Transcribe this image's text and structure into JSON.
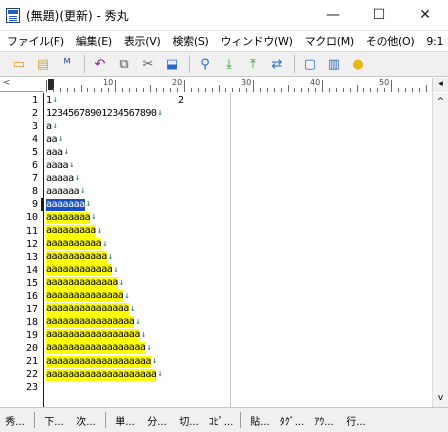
{
  "window": {
    "title": "(無題)(更新) - 秀丸",
    "minimize_glyph": "—",
    "maximize_glyph": "☐",
    "close_glyph": "✕"
  },
  "menu": [
    {
      "label": "ファイル(F)"
    },
    {
      "label": "編集(E)"
    },
    {
      "label": "表示(V)"
    },
    {
      "label": "検索(S)"
    },
    {
      "label": "ウィンドウ(W)"
    },
    {
      "label": "マクロ(M)"
    },
    {
      "label": "その他(O)"
    },
    {
      "label": "9:1"
    }
  ],
  "toolbar": [
    {
      "icon": "new-file-icon",
      "glyph": "▭",
      "color": "#d89a2b"
    },
    {
      "icon": "open-folder-icon",
      "glyph": "▤",
      "color": "#d8a83a"
    },
    {
      "icon": "save-icon",
      "glyph": "ᴹ",
      "color": "#1c3f8f"
    },
    {
      "icon": "undo-icon",
      "glyph": "↶",
      "color": "#8e1b80"
    },
    {
      "icon": "copy-icon",
      "glyph": "⧉",
      "color": "#5a5a5a"
    },
    {
      "icon": "cut-icon",
      "glyph": "✂",
      "color": "#5a5a5a"
    },
    {
      "icon": "paste-icon",
      "glyph": "⬓",
      "color": "#2b6bd0"
    },
    {
      "icon": "search-icon",
      "glyph": "⚲",
      "color": "#2b6bd0"
    },
    {
      "icon": "search-down-icon",
      "glyph": "⤓",
      "color": "#2a9c2a"
    },
    {
      "icon": "search-up-icon",
      "glyph": "⤒",
      "color": "#2a9c2a"
    },
    {
      "icon": "grep-icon",
      "glyph": "⇄",
      "color": "#2b6bd0"
    },
    {
      "icon": "window-split-icon",
      "glyph": "▢",
      "color": "#2b6bd0"
    },
    {
      "icon": "window-layout-icon",
      "glyph": "▥",
      "color": "#2b6bd0"
    },
    {
      "icon": "help-icon",
      "glyph": "●",
      "color": "#e8b51a"
    }
  ],
  "ruler": {
    "corner": "<",
    "scroll_glyph": "◂",
    "numbers": [
      "10",
      "20",
      "30",
      "40",
      "50"
    ]
  },
  "colors": {
    "highlight": "#ffff00",
    "selection": "#1a4fc0",
    "eol_mark": "#1c7b46"
  },
  "editor": {
    "lines": [
      {
        "num": "1",
        "text": "1",
        "ruler_col2": "2"
      },
      {
        "num": "2",
        "text": "12345678901234567890"
      },
      {
        "num": "3",
        "text": "a"
      },
      {
        "num": "4",
        "text": "aa"
      },
      {
        "num": "5",
        "text": "aaa"
      },
      {
        "num": "6",
        "text": "aaaa"
      },
      {
        "num": "7",
        "text": "aaaaa"
      },
      {
        "num": "8",
        "text": "aaaaaa"
      },
      {
        "num": "9",
        "text": "aaaaaaa",
        "style": "selected"
      },
      {
        "num": "10",
        "text": "aaaaaaaa",
        "style": "highlight"
      },
      {
        "num": "11",
        "text": "aaaaaaaaa",
        "style": "highlight"
      },
      {
        "num": "12",
        "text": "aaaaaaaaaa",
        "style": "highlight"
      },
      {
        "num": "13",
        "text": "aaaaaaaaaaa",
        "style": "highlight"
      },
      {
        "num": "14",
        "text": "aaaaaaaaaaaa",
        "style": "highlight"
      },
      {
        "num": "15",
        "text": "aaaaaaaaaaaaa",
        "style": "highlight"
      },
      {
        "num": "16",
        "text": "aaaaaaaaaaaaaa",
        "style": "highlight"
      },
      {
        "num": "17",
        "text": "aaaaaaaaaaaaaaa",
        "style": "highlight"
      },
      {
        "num": "18",
        "text": "aaaaaaaaaaaaaaaa",
        "style": "highlight"
      },
      {
        "num": "19",
        "text": "aaaaaaaaaaaaaaaaa",
        "style": "highlight"
      },
      {
        "num": "20",
        "text": "aaaaaaaaaaaaaaaaaa",
        "style": "highlight"
      },
      {
        "num": "21",
        "text": "aaaaaaaaaaaaaaaaaaa",
        "style": "highlight"
      },
      {
        "num": "22",
        "text": "aaaaaaaaaaaaaaaaaaaa",
        "style": "highlight"
      },
      {
        "num": "23",
        "text": ""
      }
    ],
    "eol_glyph": "↓"
  },
  "scrollbar": {
    "up_glyph": "^",
    "down_glyph": "v"
  },
  "fkeys": [
    {
      "label": "秀..."
    },
    {
      "sep": true
    },
    {
      "label": "下..."
    },
    {
      "label": "次..."
    },
    {
      "sep": true
    },
    {
      "label": "単..."
    },
    {
      "label": "分..."
    },
    {
      "label": "切..."
    },
    {
      "label": "ｺﾋﾟ..."
    },
    {
      "sep": true
    },
    {
      "label": "貼..."
    },
    {
      "label": "ﾀｸﾞ..."
    },
    {
      "label": "ｱｳ..."
    },
    {
      "label": "行..."
    }
  ]
}
